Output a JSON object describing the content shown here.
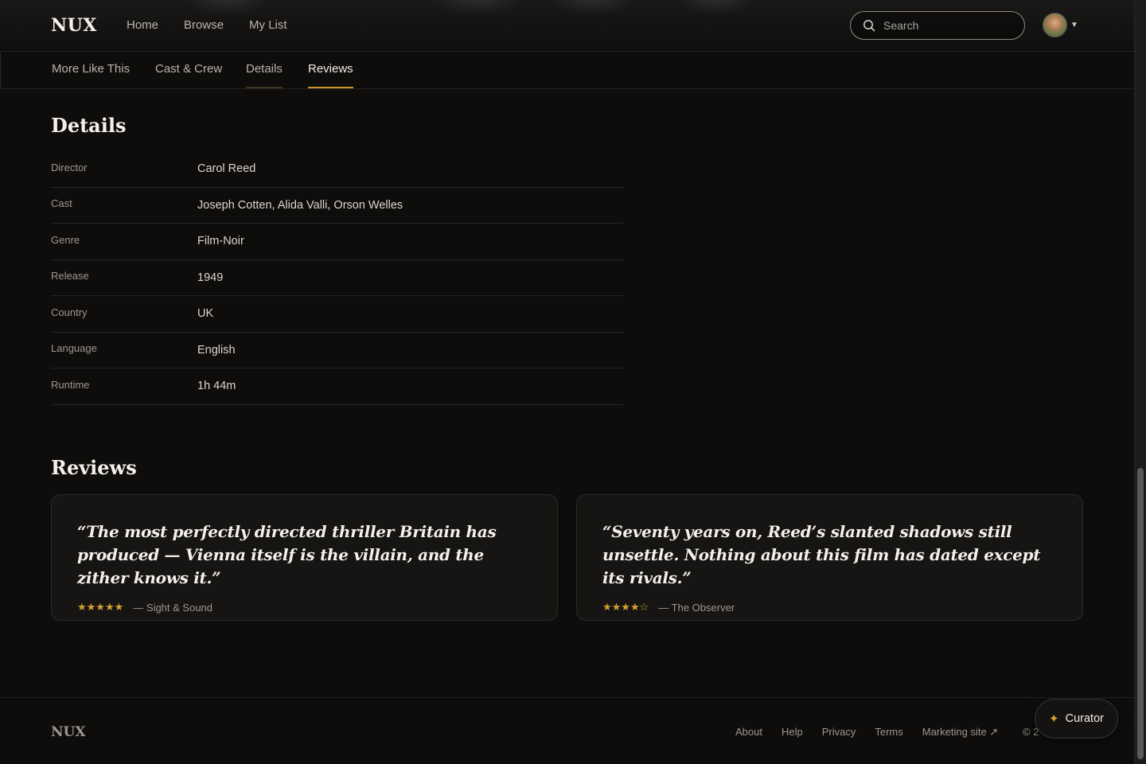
{
  "header": {
    "logo": "NUX",
    "nav": [
      "Home",
      "Browse",
      "My List"
    ],
    "search_placeholder": "Search"
  },
  "tabs": [
    "More Like This",
    "Cast & Crew",
    "Details",
    "Reviews"
  ],
  "active_tab": "Reviews",
  "details": {
    "title": "Details",
    "rows": [
      {
        "label": "Director",
        "value": "Carol Reed"
      },
      {
        "label": "Cast",
        "value": "Joseph Cotten, Alida Valli, Orson Welles"
      },
      {
        "label": "Genre",
        "value": "Film-Noir"
      },
      {
        "label": "Release",
        "value": "1949"
      },
      {
        "label": "Country",
        "value": "UK"
      },
      {
        "label": "Language",
        "value": "English"
      },
      {
        "label": "Runtime",
        "value": "1h 44m"
      }
    ]
  },
  "reviews": {
    "title": "Reviews",
    "items": [
      {
        "quote": "“The most perfectly directed thriller Britain has produced — Vienna itself is the villain, and the zither knows it.”",
        "stars": "★★★★★",
        "rating": 5,
        "source": "— Sight & Sound"
      },
      {
        "quote": "“Seventy years on, Reed’s slanted shadows still unsettle. Nothing about this film has dated except its rivals.”",
        "stars": "★★★★☆",
        "rating": 4,
        "source": "— The Observer"
      }
    ]
  },
  "footer": {
    "logo": "NUX",
    "links": [
      "About",
      "Help",
      "Privacy",
      "Terms",
      "Marketing site ↗"
    ],
    "copyright": "© 2"
  },
  "curator_button": "Curator",
  "colors": {
    "accent": "#c8922c",
    "star": "#d4a230",
    "background": "#0e0d0c"
  },
  "icons": [
    "search-icon",
    "chevron-down-icon",
    "sparkle-icon",
    "avatar"
  ]
}
